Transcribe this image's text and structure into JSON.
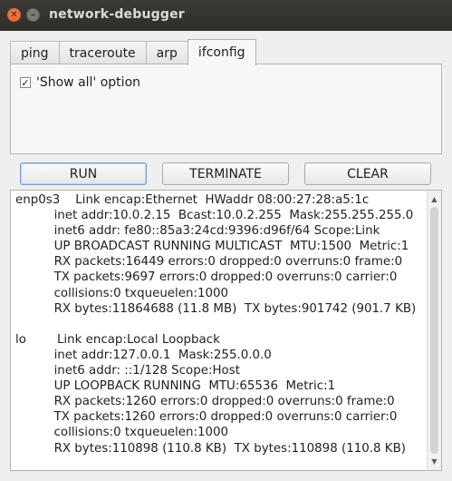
{
  "window": {
    "title": "network-debugger",
    "close_glyph": "✕",
    "minimize_glyph": "–"
  },
  "tabs": [
    {
      "label": "ping",
      "active": false
    },
    {
      "label": "traceroute",
      "active": false
    },
    {
      "label": "arp",
      "active": false
    },
    {
      "label": "ifconfig",
      "active": true
    }
  ],
  "options": {
    "show_all": {
      "label": "'Show all' option",
      "checked": true,
      "check_glyph": "✓"
    }
  },
  "buttons": {
    "run": "RUN",
    "terminate": "TERMINATE",
    "clear": "CLEAR"
  },
  "output": {
    "text": "enp0s3    Link encap:Ethernet  HWaddr 08:00:27:28:a5:1c  \n          inet addr:10.0.2.15  Bcast:10.0.2.255  Mask:255.255.255.0\n          inet6 addr: fe80::85a3:24cd:9396:d96f/64 Scope:Link\n          UP BROADCAST RUNNING MULTICAST  MTU:1500  Metric:1\n          RX packets:16449 errors:0 dropped:0 overruns:0 frame:0\n          TX packets:9697 errors:0 dropped:0 overruns:0 carrier:0\n          collisions:0 txqueuelen:1000 \n          RX bytes:11864688 (11.8 MB)  TX bytes:901742 (901.7 KB)\n\nlo        Link encap:Local Loopback  \n          inet addr:127.0.0.1  Mask:255.0.0.0\n          inet6 addr: ::1/128 Scope:Host\n          UP LOOPBACK RUNNING  MTU:65536  Metric:1\n          RX packets:1260 errors:0 dropped:0 overruns:0 frame:0\n          TX packets:1260 errors:0 dropped:0 overruns:0 carrier:0\n          collisions:0 txqueuelen:1000 \n          RX bytes:110898 (110.8 KB)  TX bytes:110898 (110.8 KB)"
  },
  "scrollbar": {
    "up_glyph": "▲",
    "down_glyph": "▼"
  },
  "colors": {
    "titlebar": "#3b3a35",
    "close_button": "#e35a28",
    "focus_border": "#6f9fd6"
  }
}
